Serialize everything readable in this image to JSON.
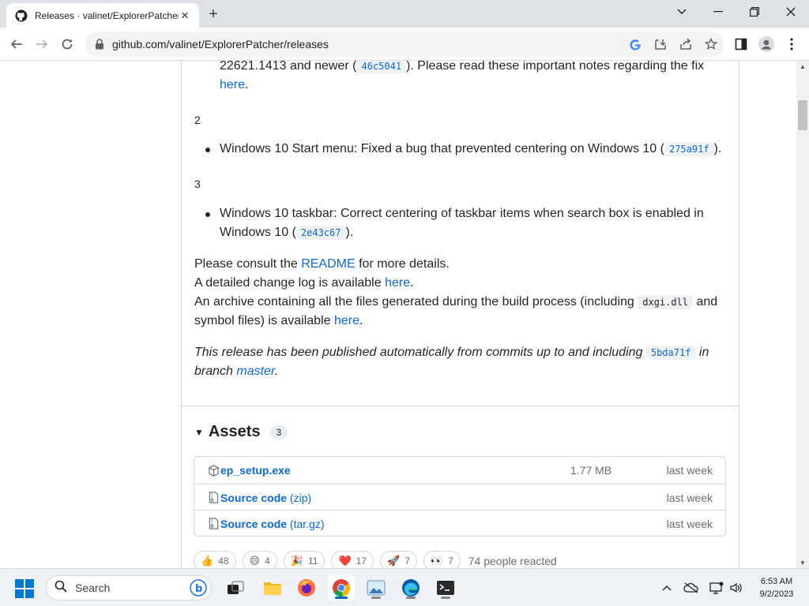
{
  "browser": {
    "tab_title": "Releases · valinet/ExplorerPatcher",
    "url": "github.com/valinet/ExplorerPatcher/releases"
  },
  "content": {
    "frag1_text": "22621.1413 and newer (",
    "frag1_code": "46c5041",
    "frag1_after": "). Please read these important notes regarding the fix",
    "frag1_link": "here",
    "frag1_end": ".",
    "item2_num": "2",
    "item2_text": "Windows 10 Start menu: Fixed a bug that prevented centering on Windows 10 (",
    "item2_code": "275a91f",
    "item2_end": ").",
    "item3_num": "3",
    "item3_text": "Windows 10 taskbar: Correct centering of taskbar items when search box is enabled in Windows 10 (",
    "item3_code": "2e43c67",
    "item3_end": ").",
    "consult_pre": "Please consult the ",
    "consult_link": "README",
    "consult_post": " for more details.",
    "changelog_pre": "A detailed change log is available ",
    "changelog_link": "here",
    "changelog_post": ".",
    "archive_pre": "An archive containing all the files generated during the build process (including ",
    "archive_code": "dxgi.dll",
    "archive_mid": " and symbol files) is available ",
    "archive_link": "here",
    "archive_post": ".",
    "auto_pre": "This release has been published automatically from commits up to and including ",
    "auto_code": "5bda71f",
    "auto_mid": " in branch ",
    "auto_link": "master",
    "auto_post": "."
  },
  "assets": {
    "title": "Assets",
    "count": "3",
    "rows": [
      {
        "name": "ep_setup.exe",
        "ext": "",
        "size": "1.77 MB",
        "date": "last week"
      },
      {
        "name": "Source code",
        "ext": " (zip)",
        "size": "",
        "date": "last week"
      },
      {
        "name": "Source code",
        "ext": " (tar.gz)",
        "size": "",
        "date": "last week"
      }
    ]
  },
  "reactions": {
    "items": [
      {
        "emoji": "👍",
        "count": "48"
      },
      {
        "emoji": "😄",
        "count": "4"
      },
      {
        "emoji": "🎉",
        "count": "11"
      },
      {
        "emoji": "❤️",
        "count": "17"
      },
      {
        "emoji": "🚀",
        "count": "7"
      },
      {
        "emoji": "👀",
        "count": "7"
      }
    ],
    "summary": "74 people reacted"
  },
  "taskbar": {
    "search_label": "Search",
    "time": "6:53 AM",
    "date": "9/2/2023"
  }
}
